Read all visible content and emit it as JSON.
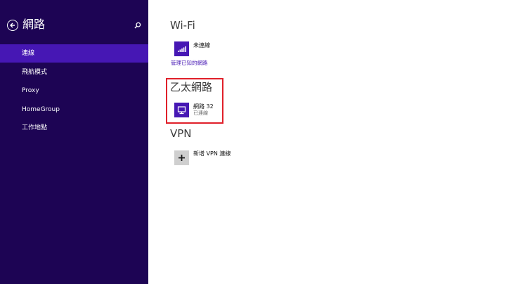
{
  "sidebar": {
    "title": "網路",
    "items": [
      {
        "label": "連線",
        "selected": true
      },
      {
        "label": "飛航模式",
        "selected": false
      },
      {
        "label": "Proxy",
        "selected": false
      },
      {
        "label": "HomeGroup",
        "selected": false
      },
      {
        "label": "工作地點",
        "selected": false
      }
    ]
  },
  "wifi": {
    "title": "Wi-Fi",
    "status": "未連線",
    "manage_link": "管理已知的網路",
    "icon": "wifi-signal-icon"
  },
  "ethernet": {
    "title": "乙太網路",
    "network_name": "網路  32",
    "status": "已連線",
    "icon": "monitor-network-icon"
  },
  "vpn": {
    "title": "VPN",
    "add_label": "新增 VPN 連線",
    "icon": "plus-icon"
  },
  "colors": {
    "sidebar_bg": "#1d0454",
    "accent": "#4617b4",
    "highlight": "#e0202a"
  }
}
